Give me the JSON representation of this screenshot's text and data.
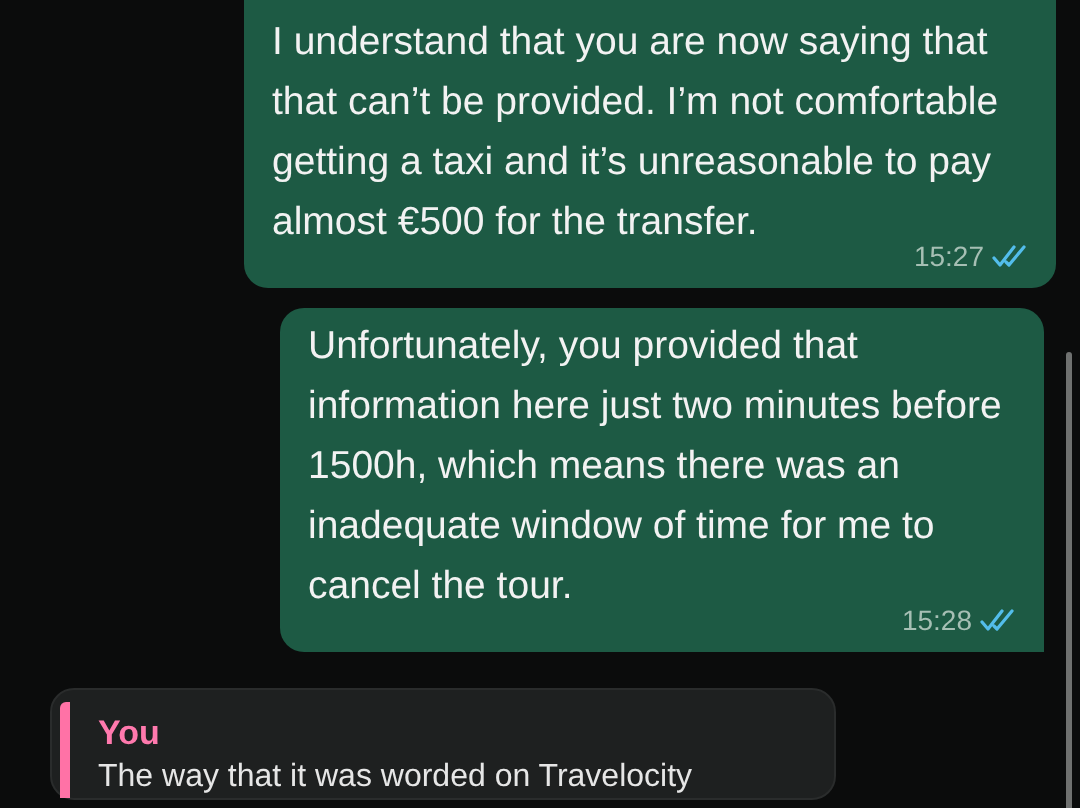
{
  "messages": [
    {
      "kind": "outgoing",
      "text": "I understand that you are now saying that that can’t be provided. I’m not comfortable getting a taxi and it’s unreasonable to pay almost €500 for the transfer.",
      "time": "15:27",
      "read": true
    },
    {
      "kind": "outgoing",
      "text": "Unfortunately, you provided that information here just two minutes before 1500h, which means there was an inadequate window of time for me to cancel the tour.",
      "time": "15:28",
      "read": true
    },
    {
      "kind": "quote",
      "author": "You",
      "text": "The way that it was worded on Travelocity"
    }
  ]
}
